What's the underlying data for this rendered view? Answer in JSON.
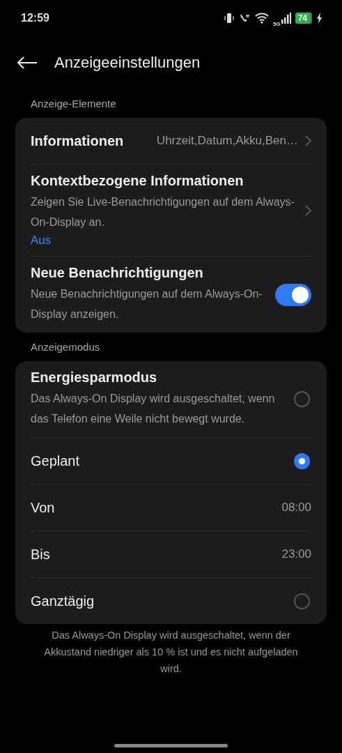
{
  "status_bar": {
    "time": "12:59",
    "network": "5G",
    "battery": "74"
  },
  "header": {
    "title": "Anzeigeeinstellungen"
  },
  "sections": [
    {
      "label": "Anzeige-Elemente",
      "rows": [
        {
          "kind": "link",
          "title": "Informationen",
          "value": "Uhrzeit,Datum,Akku,Ben…"
        },
        {
          "kind": "link",
          "title": "Kontextbezogene Informationen",
          "subtitle": "Zeigen Sie Live-Benachrichtigungen auf dem Always-On-Display an.",
          "status": "Aus"
        },
        {
          "kind": "toggle",
          "title": "Neue Benachrichtigungen",
          "subtitle": "Neue Benachrichtigungen auf dem Always-On-Display anzeigen.",
          "on": true
        }
      ]
    },
    {
      "label": "Anzeigemodus",
      "rows": [
        {
          "kind": "radio",
          "title": "Energiesparmodus",
          "subtitle": "Das Always-On Display wird ausgeschaltet, wenn das Telefon eine Weile nicht bewegt wurde.",
          "selected": false
        },
        {
          "kind": "radio",
          "title": "Geplant",
          "selected": true
        },
        {
          "kind": "value",
          "title": "Von",
          "value": "08:00"
        },
        {
          "kind": "value",
          "title": "Bis",
          "value": "23:00"
        },
        {
          "kind": "radio",
          "title": "Ganztägig",
          "selected": false
        }
      ]
    }
  ],
  "footer": "Das Always-On Display wird ausgeschaltet, wenn der Akkustand niedriger als 10 % ist und es nicht aufgeladen wird."
}
